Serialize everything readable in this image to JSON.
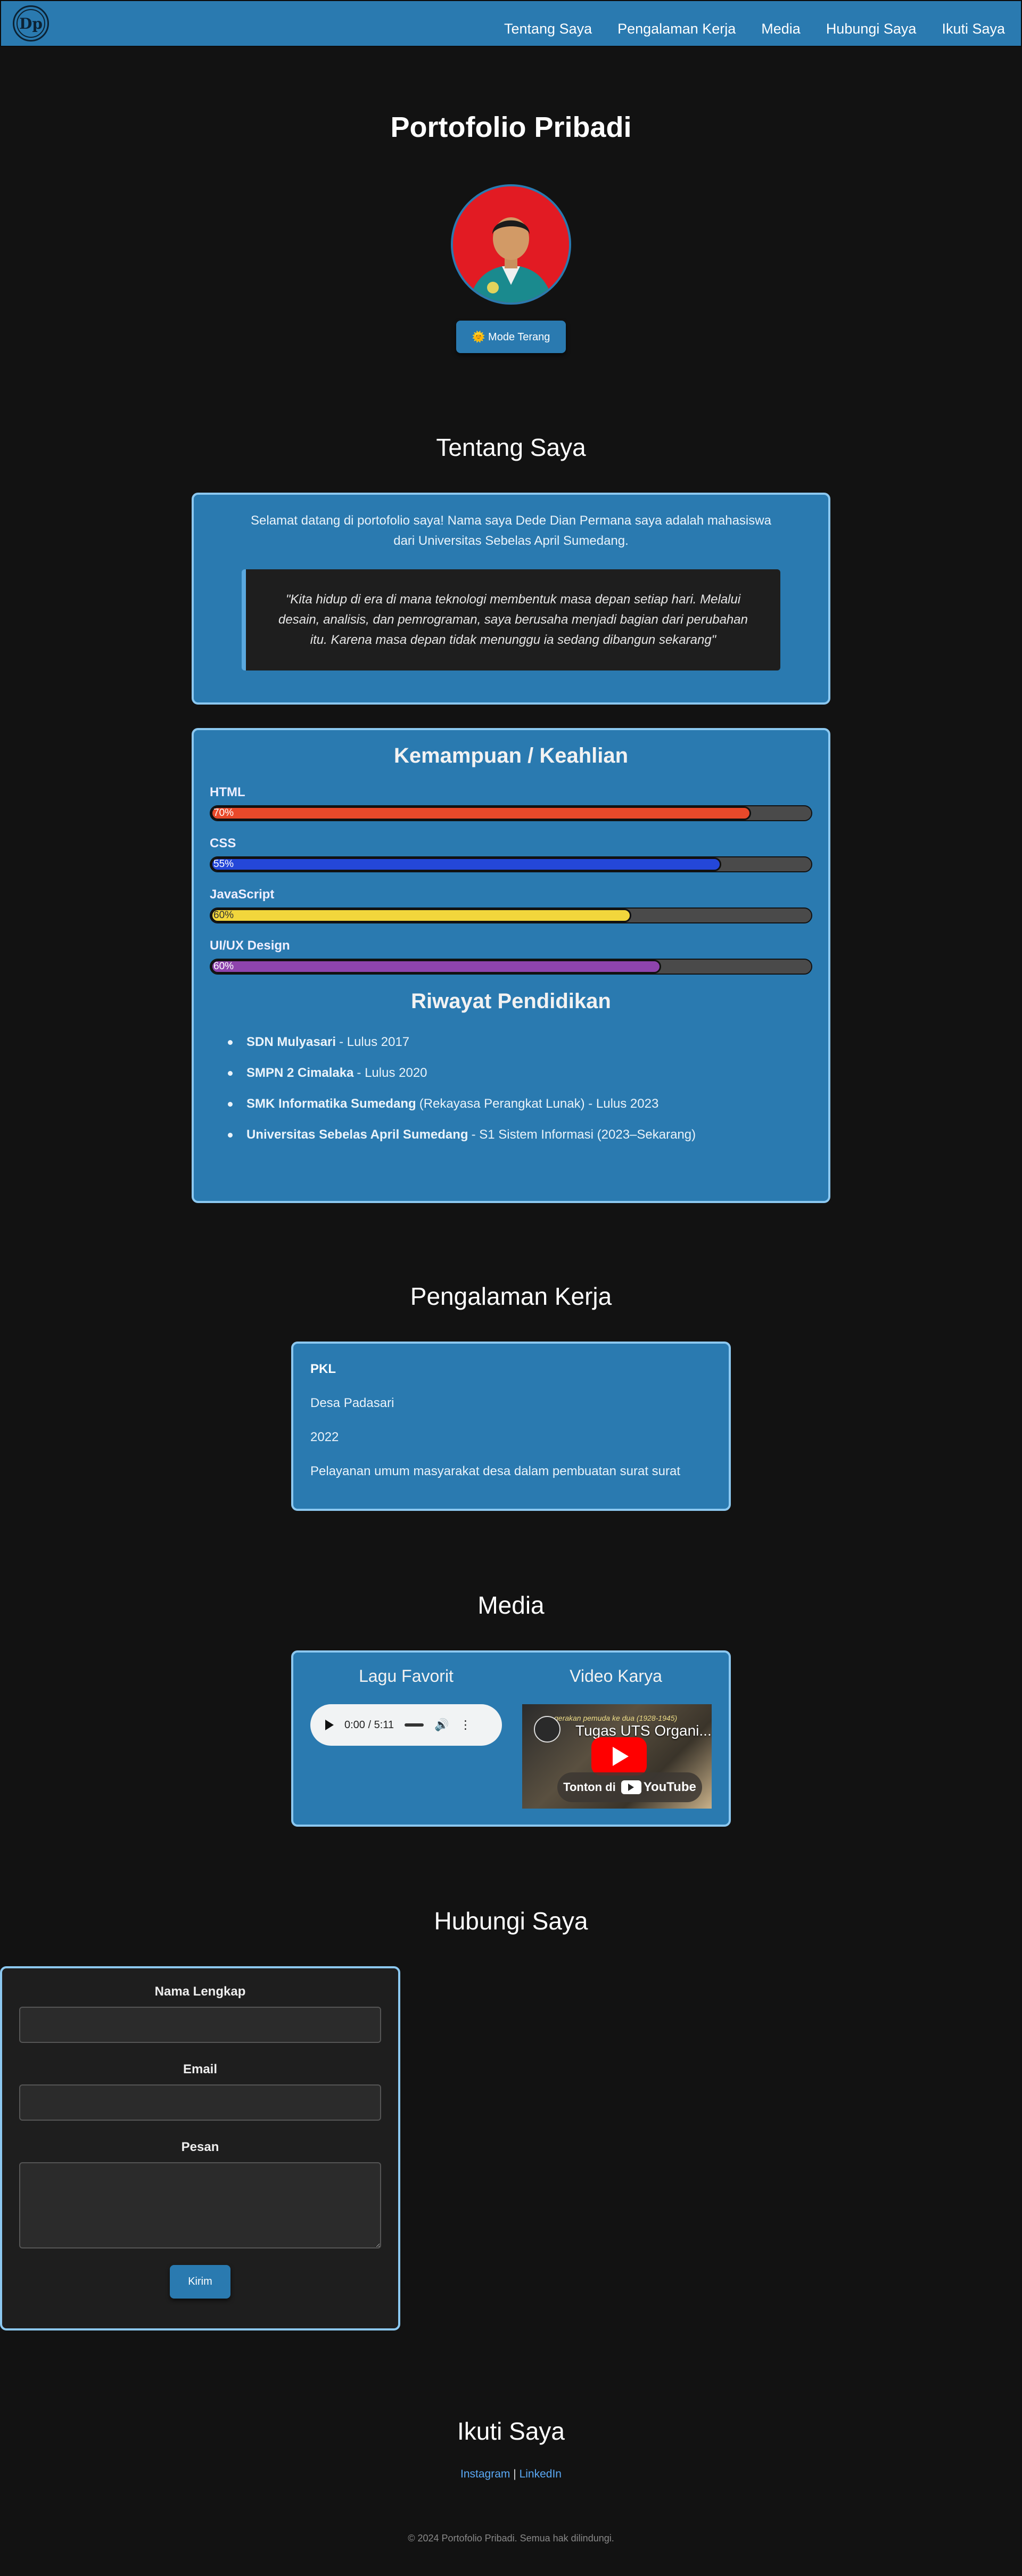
{
  "nav": {
    "logo_text": "Dp",
    "links": [
      "Tentang Saya",
      "Pengalaman Kerja",
      "Media",
      "Hubungi Saya",
      "Ikuti Saya"
    ]
  },
  "hero": {
    "title": "Portofolio Pribadi",
    "mode_button": "🌞 Mode Terang"
  },
  "about": {
    "title": "Tentang Saya",
    "text": "Selamat datang di portofolio saya! Nama saya Dede Dian Permana saya adalah mahasiswa dari Universitas Sebelas April Sumedang.",
    "quote": "\"Kita hidup di era di mana teknologi membentuk masa depan setiap hari. Melalui desain, analisis, dan pemrograman, saya berusaha menjadi bagian dari perubahan itu. Karena masa depan tidak menunggu ia sedang dibangun sekarang\""
  },
  "skills": {
    "title": "Kemampuan / Keahlian",
    "items": [
      {
        "name": "HTML",
        "label": "70%",
        "value": 0.9,
        "color": "#e8492a",
        "text_color": "#ffffff"
      },
      {
        "name": "CSS",
        "label": "55%",
        "value": 0.85,
        "color": "#2447d8",
        "text_color": "#ffffff"
      },
      {
        "name": "JavaScript",
        "label": "60%",
        "value": 0.7,
        "color": "#f2d63c",
        "text_color": "#333333"
      },
      {
        "name": "UI/UX Design",
        "label": "60%",
        "value": 0.75,
        "color": "#8e44ad",
        "text_color": "#ffffff"
      }
    ]
  },
  "education": {
    "title": "Riwayat Pendidikan",
    "items": [
      {
        "school": "SDN Mulyasari",
        "detail": "- Lulus 2017"
      },
      {
        "school": "SMPN 2 Cimalaka",
        "detail": "- Lulus 2020"
      },
      {
        "school": "SMK Informatika Sumedang",
        "detail": "(Rekayasa Perangkat Lunak) - Lulus 2023"
      },
      {
        "school": "Universitas Sebelas April Sumedang",
        "detail": "- S1 Sistem Informasi (2023–Sekarang)"
      }
    ]
  },
  "experience": {
    "title": "Pengalaman Kerja",
    "role": "PKL",
    "place": "Desa Padasari",
    "year": "2022",
    "description": "Pelayanan umum masyarakat desa dalam pembuatan surat surat"
  },
  "media": {
    "title": "Media",
    "song_title": "Lagu Favorit",
    "audio_time": "0:00 / 5:11",
    "video_title": "Video Karya",
    "video_caption": "Tugas UTS Organi...",
    "video_top_text": "gerakan pemuda ke dua (1928-1945)",
    "watch_label": "Tonton di",
    "youtube_label": "YouTube"
  },
  "contact": {
    "title": "Hubungi Saya",
    "name_label": "Nama Lengkap",
    "email_label": "Email",
    "message_label": "Pesan",
    "name_value": "",
    "email_value": "",
    "message_value": "",
    "submit": "Kirim"
  },
  "follow": {
    "title": "Ikuti Saya",
    "instagram": "Instagram",
    "separator": "|",
    "linkedin": "LinkedIn"
  },
  "footer": "© 2024 Portofolio Pribadi. Semua hak dilindungi."
}
